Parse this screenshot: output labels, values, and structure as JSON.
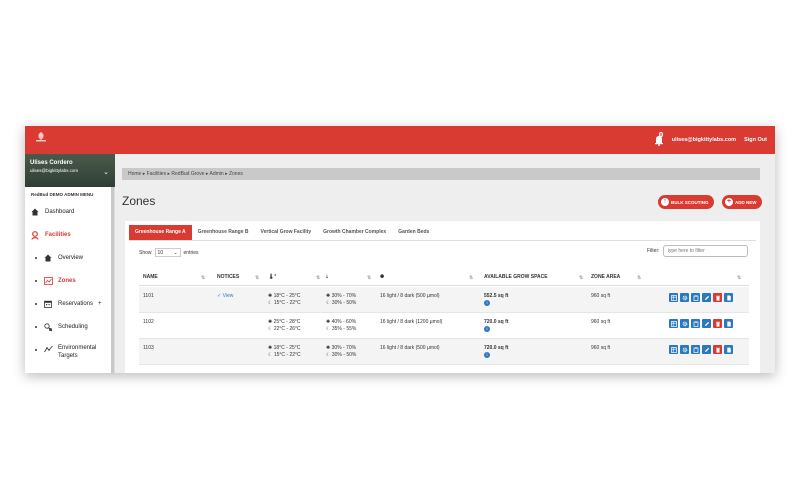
{
  "topbar": {
    "notification_count": "0",
    "user_email": "ulises@bigkittylabs.com",
    "sign_out": "Sign Out"
  },
  "sidebar": {
    "user_name": "Ulises Cordero",
    "user_email": "ulises@bigkittylabs.com",
    "menu_title": "RedBud DEMO ADMIN MENU",
    "items": {
      "dashboard": "Dashboard",
      "facilities": "Facilities",
      "overview": "Overview",
      "zones": "Zones",
      "reservations": "Reservations",
      "reservations_plus": "+",
      "scheduling": "Scheduling",
      "environmental_targets_1": "Environmental",
      "environmental_targets_2": "Targets"
    }
  },
  "breadcrumb": {
    "home": "Home",
    "facilities": "Facilities",
    "grove": "RedBud Grove",
    "admin": "Admin",
    "zones": "Zones"
  },
  "page": {
    "title": "Zones",
    "bulk_scouting": "BULK SCOUTING",
    "add_new": "ADD NEW"
  },
  "tabs": [
    "Greenhouse Range A",
    "Greenhouse Range B",
    "Vertical Grow Facility",
    "Growth Chamber Complex",
    "Garden Beds"
  ],
  "controls": {
    "show_label": "Show",
    "entries_value": "10",
    "entries_label": "entries",
    "filter_label": "Filter:",
    "filter_placeholder": "type here to filter"
  },
  "table": {
    "headers": {
      "name": "NAME",
      "notices": "NOTICES",
      "available_space": "AVAILABLE GROW SPACE",
      "zone_area": "ZONE AREA"
    },
    "rows": [
      {
        "name": "1101",
        "notice": "View",
        "temp_day": "18°C - 25°C",
        "temp_night": "15°C - 22°C",
        "hum_day": "30% - 70%",
        "hum_night": "30% - 50%",
        "light": "16 light / 8 dark (500 µmol)",
        "space": "552.5 sq ft",
        "area": "960 sq ft"
      },
      {
        "name": "1102",
        "notice": "",
        "temp_day": "25°C - 28°C",
        "temp_night": "22°C - 26°C",
        "hum_day": "40% - 60%",
        "hum_night": "35% - 55%",
        "light": "16 light / 8 dark (1200 µmol)",
        "space": "720.0 sq ft",
        "area": "960 sq ft"
      },
      {
        "name": "1103",
        "notice": "",
        "temp_day": "18°C - 25°C",
        "temp_night": "15°C - 22°C",
        "hum_day": "30% - 70%",
        "hum_night": "30% - 50%",
        "light": "16 light / 8 dark (500 µmol)",
        "space": "720.0 sq ft",
        "area": "960 sq ft"
      }
    ]
  },
  "colors": {
    "brand": "#d93a32",
    "action_blue": "#2a78c2",
    "action_red": "#d93a32"
  }
}
